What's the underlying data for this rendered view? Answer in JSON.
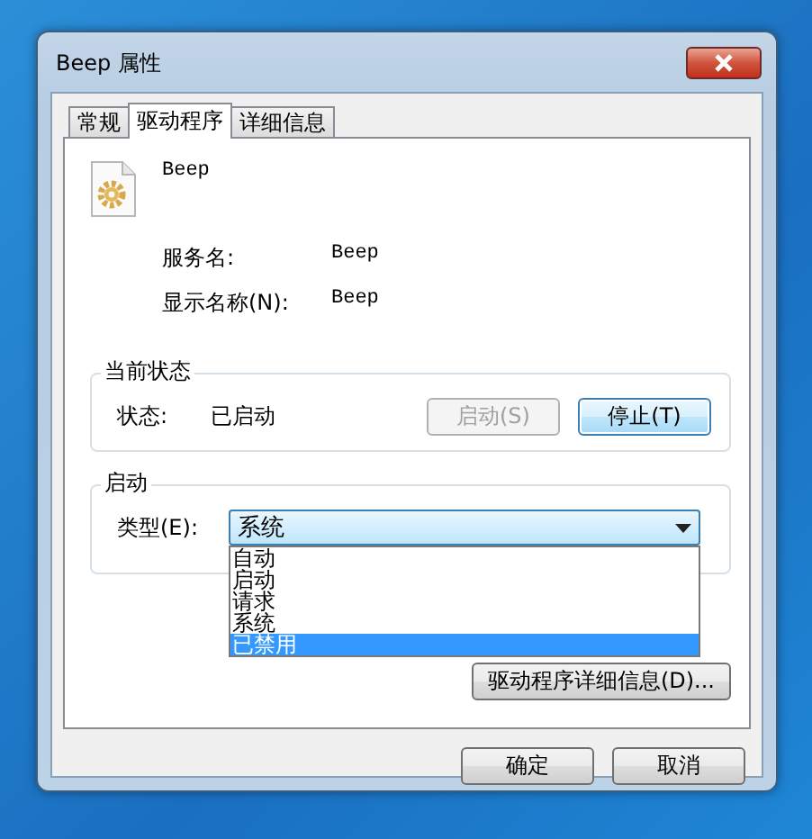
{
  "window": {
    "title": "Beep 属性"
  },
  "tabs": [
    {
      "label": "常规",
      "selected": false
    },
    {
      "label": "驱动程序",
      "selected": true
    },
    {
      "label": "详细信息",
      "selected": false
    }
  ],
  "service": {
    "name": "Beep",
    "fields": [
      {
        "label": "服务名:",
        "value": "Beep"
      },
      {
        "label": "显示名称(N):",
        "value": "Beep"
      }
    ]
  },
  "status_group": {
    "title": "当前状态",
    "label": "状态:",
    "value": "已启动",
    "buttons": [
      {
        "label": "启动(S)",
        "disabled": true
      },
      {
        "label": "停止(T)",
        "disabled": false
      }
    ]
  },
  "startup_group": {
    "title": "启动",
    "type_label": "类型(E):",
    "type_value": "系统",
    "expanded": true,
    "options": [
      {
        "label": "自动",
        "selected": false
      },
      {
        "label": "启动",
        "selected": false
      },
      {
        "label": "请求",
        "selected": false
      },
      {
        "label": "系统",
        "selected": false
      },
      {
        "label": "已禁用",
        "selected": true
      }
    ]
  },
  "details_button": "驱动程序详细信息(D)...",
  "buttons": [
    {
      "label": "确定"
    },
    {
      "label": "取消"
    }
  ]
}
